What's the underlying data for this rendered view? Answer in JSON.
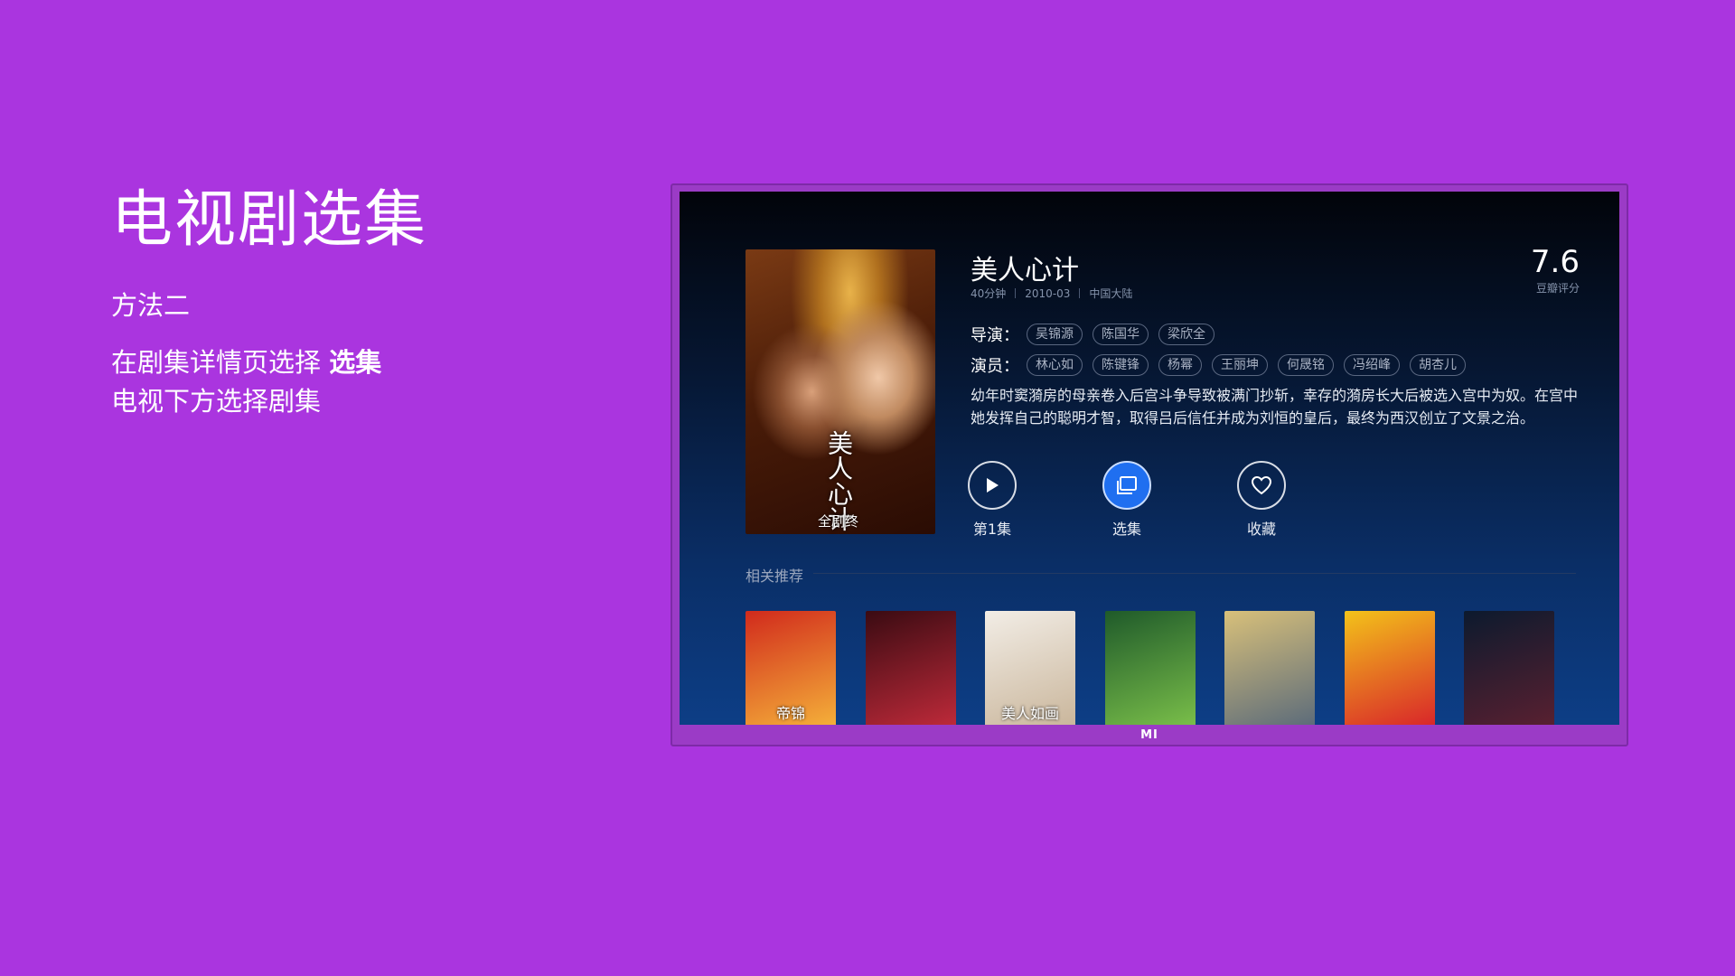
{
  "intro": {
    "title": "电视剧选集",
    "method": "方法二",
    "line1_prefix": "在剧集详情页选择 ",
    "line1_bold": "选集",
    "line2": "电视下方选择剧集"
  },
  "tv": {
    "logo": "MI"
  },
  "detail": {
    "title": "美人心计",
    "meta": [
      "40分钟",
      "2010-03",
      "中国大陆"
    ],
    "score": "7.6",
    "score_label": "豆瓣评分",
    "director_label": "导演：",
    "directors": [
      "吴锦源",
      "陈国华",
      "梁欣全"
    ],
    "cast_label": "演员：",
    "cast": [
      "林心如",
      "陈键锋",
      "杨幂",
      "王丽坤",
      "何晟铭",
      "冯绍峰",
      "胡杏儿"
    ],
    "synopsis": "幼年时窦漪房的母亲卷入后宫斗争导致被满门抄斩，幸存的漪房长大后被选入宫中为奴。在宫中她发挥自己的聪明才智，取得吕后信任并成为刘恒的皇后，最终为西汉创立了文景之治。",
    "poster_title": "美人心计",
    "poster_tag": "全剧终"
  },
  "actions": {
    "play_label": "第1集",
    "episodes_label": "选集",
    "favorite_label": "收藏"
  },
  "related": {
    "title": "相关推荐",
    "items": [
      {
        "caption": "帝锦",
        "colors": [
          "#d12a1c",
          "#f5b23a"
        ]
      },
      {
        "caption": "",
        "colors": [
          "#3a0b12",
          "#c02a3a"
        ]
      },
      {
        "caption": "美人如画",
        "colors": [
          "#f2ede6",
          "#c9b59a"
        ]
      },
      {
        "caption": "",
        "colors": [
          "#1f5a2a",
          "#7bc04a"
        ]
      },
      {
        "caption": "",
        "colors": [
          "#d8c07a",
          "#5a6a7a"
        ]
      },
      {
        "caption": "",
        "colors": [
          "#f3c21a",
          "#d8232a"
        ]
      },
      {
        "caption": "",
        "colors": [
          "#0c1a2e",
          "#5a2030"
        ]
      }
    ]
  }
}
